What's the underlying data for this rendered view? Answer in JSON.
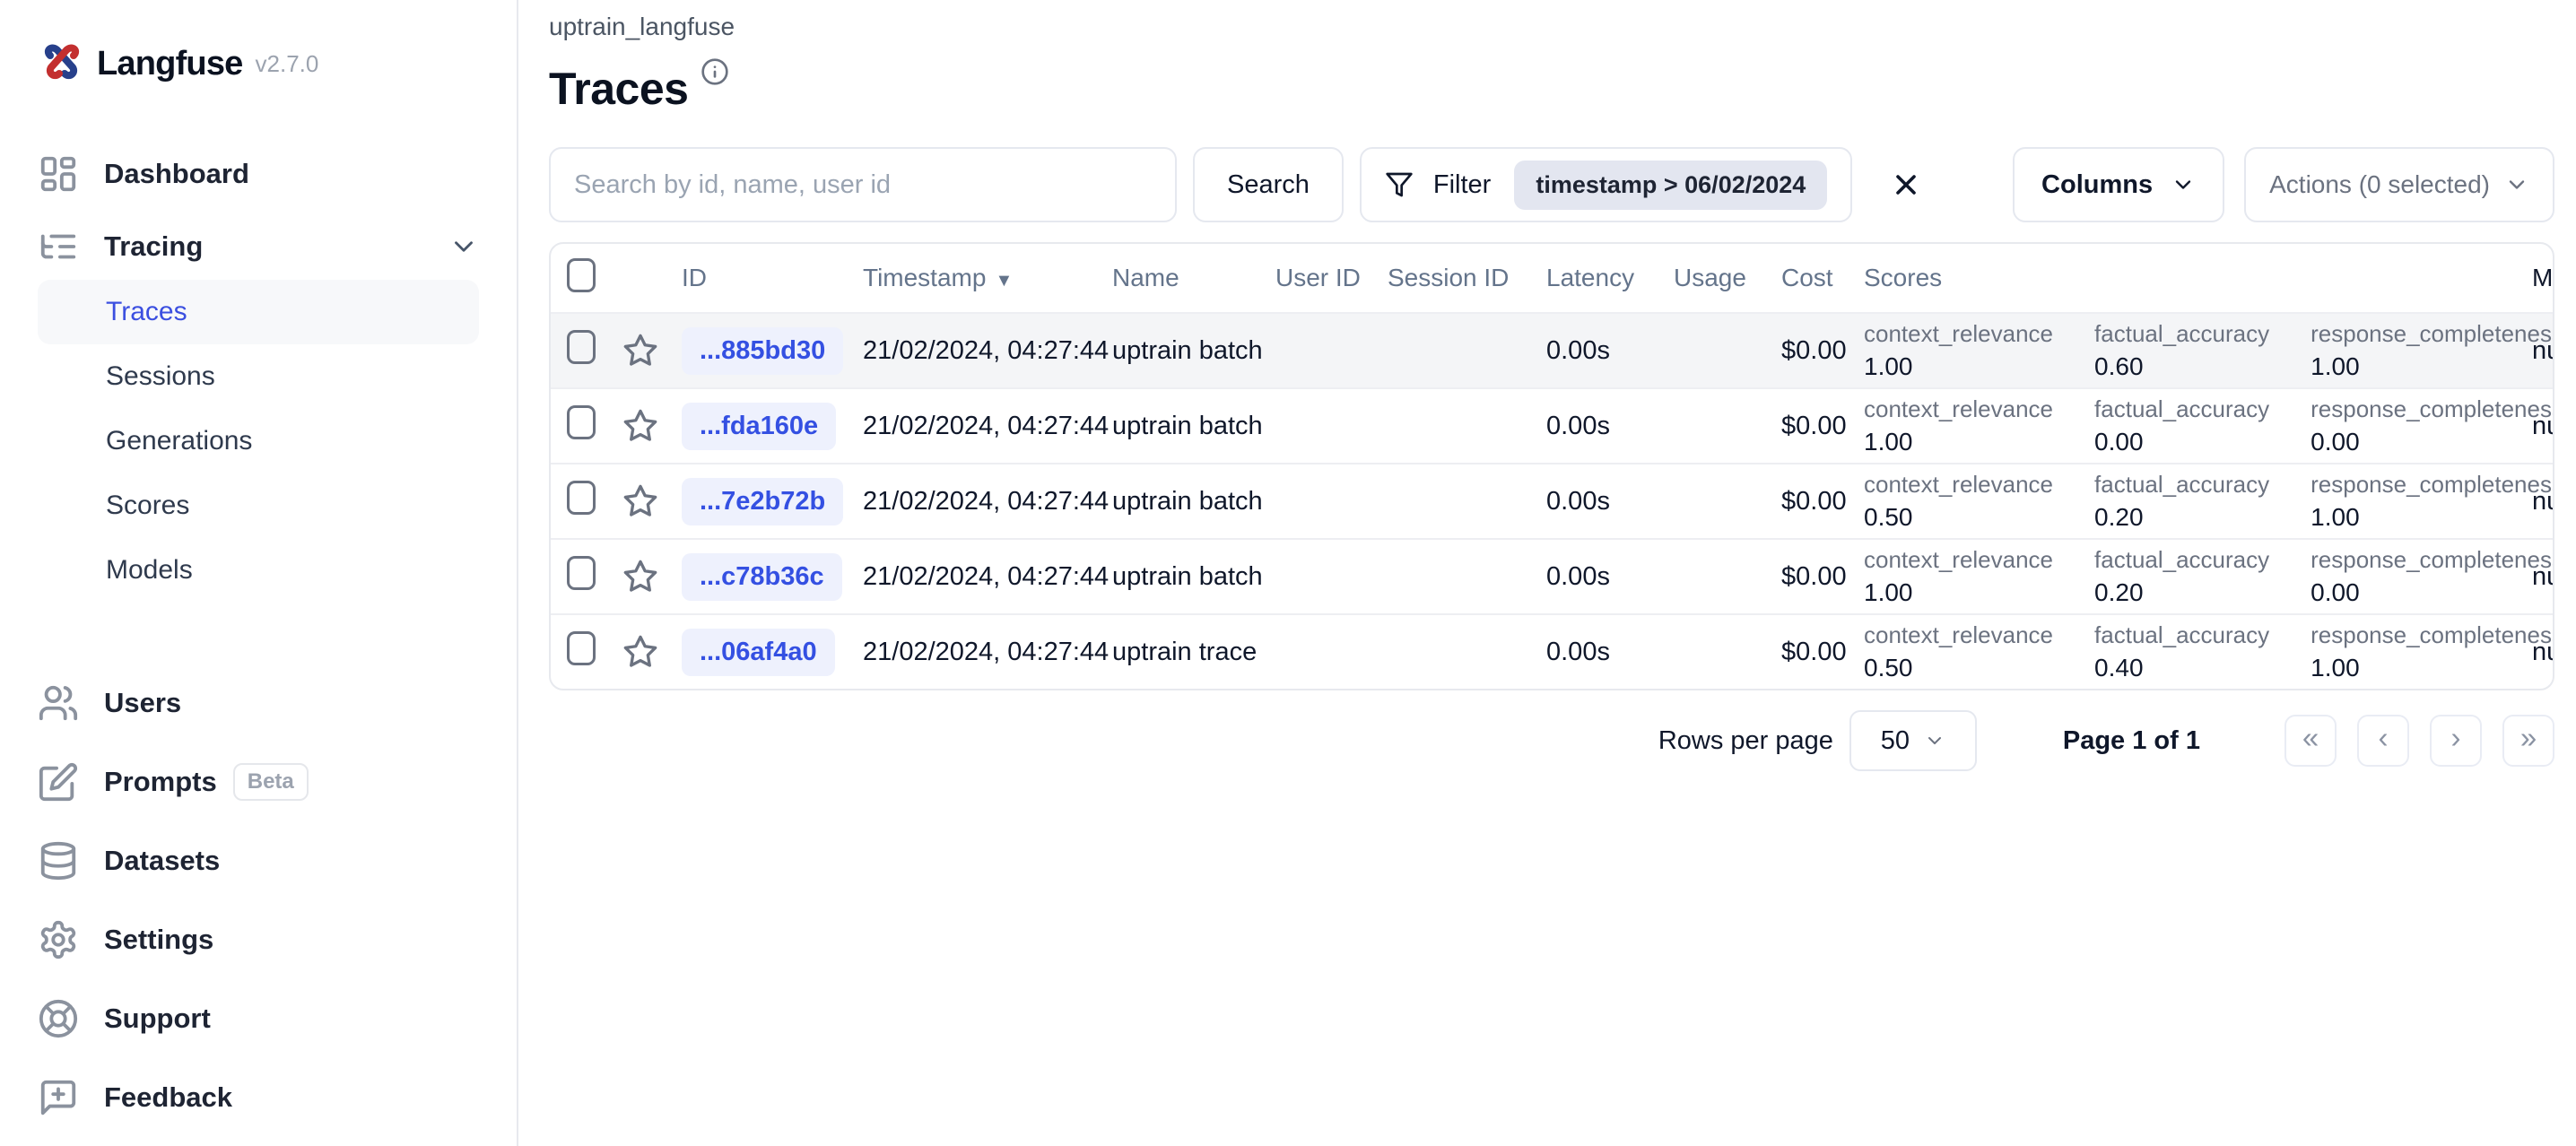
{
  "app": {
    "name": "Langfuse",
    "version": "v2.7.0"
  },
  "sidebar": {
    "dashboard": {
      "label": "Dashboard"
    },
    "tracing": {
      "label": "Tracing"
    },
    "tracing_children": [
      {
        "label": "Traces",
        "active": true
      },
      {
        "label": "Sessions",
        "active": false
      },
      {
        "label": "Generations",
        "active": false
      },
      {
        "label": "Scores",
        "active": false
      },
      {
        "label": "Models",
        "active": false
      }
    ],
    "bottom_items": [
      {
        "label": "Users"
      },
      {
        "label": "Prompts",
        "badge": "Beta"
      },
      {
        "label": "Datasets"
      },
      {
        "label": "Settings"
      },
      {
        "label": "Support"
      },
      {
        "label": "Feedback"
      }
    ]
  },
  "header": {
    "breadcrumb": "uptrain_langfuse",
    "title": "Traces"
  },
  "toolbar": {
    "search_placeholder": "Search by id, name, user id",
    "search_button": "Search",
    "filter_label": "Filter",
    "filter_chip": "timestamp > 06/02/2024",
    "columns_button": "Columns",
    "actions_button": "Actions (0 selected)"
  },
  "table": {
    "headers": {
      "id": "ID",
      "timestamp": "Timestamp",
      "name": "Name",
      "user_id": "User ID",
      "session_id": "Session ID",
      "latency": "Latency",
      "usage": "Usage",
      "cost": "Cost",
      "scores": "Scores",
      "metadata_clipped": "M"
    },
    "rows": [
      {
        "id": "...885bd30",
        "timestamp": "21/02/2024, 04:27:44",
        "name": "uptrain batch",
        "latency": "0.00s",
        "cost": "$0.00",
        "scores": [
          {
            "label": "context_relevance",
            "value": "1.00"
          },
          {
            "label": "factual_accuracy",
            "value": "0.60"
          },
          {
            "label": "response_completeness",
            "value": "1.00"
          }
        ],
        "metadata_clipped": "nu"
      },
      {
        "id": "...fda160e",
        "timestamp": "21/02/2024, 04:27:44",
        "name": "uptrain batch",
        "latency": "0.00s",
        "cost": "$0.00",
        "scores": [
          {
            "label": "context_relevance",
            "value": "1.00"
          },
          {
            "label": "factual_accuracy",
            "value": "0.00"
          },
          {
            "label": "response_completeness",
            "value": "0.00"
          }
        ],
        "metadata_clipped": "nu"
      },
      {
        "id": "...7e2b72b",
        "timestamp": "21/02/2024, 04:27:44",
        "name": "uptrain batch",
        "latency": "0.00s",
        "cost": "$0.00",
        "scores": [
          {
            "label": "context_relevance",
            "value": "0.50"
          },
          {
            "label": "factual_accuracy",
            "value": "0.20"
          },
          {
            "label": "response_completeness",
            "value": "1.00"
          }
        ],
        "metadata_clipped": "nu"
      },
      {
        "id": "...c78b36c",
        "timestamp": "21/02/2024, 04:27:44",
        "name": "uptrain batch",
        "latency": "0.00s",
        "cost": "$0.00",
        "scores": [
          {
            "label": "context_relevance",
            "value": "1.00"
          },
          {
            "label": "factual_accuracy",
            "value": "0.20"
          },
          {
            "label": "response_completeness",
            "value": "0.00"
          }
        ],
        "metadata_clipped": "nu"
      },
      {
        "id": "...06af4a0",
        "timestamp": "21/02/2024, 04:27:44",
        "name": "uptrain trace",
        "latency": "0.00s",
        "cost": "$0.00",
        "scores": [
          {
            "label": "context_relevance",
            "value": "0.50"
          },
          {
            "label": "factual_accuracy",
            "value": "0.40"
          },
          {
            "label": "response_completeness",
            "value": "1.00"
          }
        ],
        "metadata_clipped": "nu"
      }
    ]
  },
  "pagination": {
    "rows_per_page_label": "Rows per page",
    "page_size": "50",
    "page_label": "Page 1 of 1"
  },
  "icons": {
    "sort_desc": "▼",
    "page_first": "«",
    "page_prev": "‹",
    "page_next": "›",
    "page_last": "»"
  },
  "colors": {
    "accent_blue": "#3450e2",
    "id_chip_bg": "#eef1fd",
    "filter_chip_bg": "#e3e6f0",
    "active_nav_bg": "#f7f8fa",
    "border": "#e7e9ee",
    "muted_text": "#64748b",
    "logo_red": "#c32f2f",
    "logo_blue": "#27408b"
  }
}
